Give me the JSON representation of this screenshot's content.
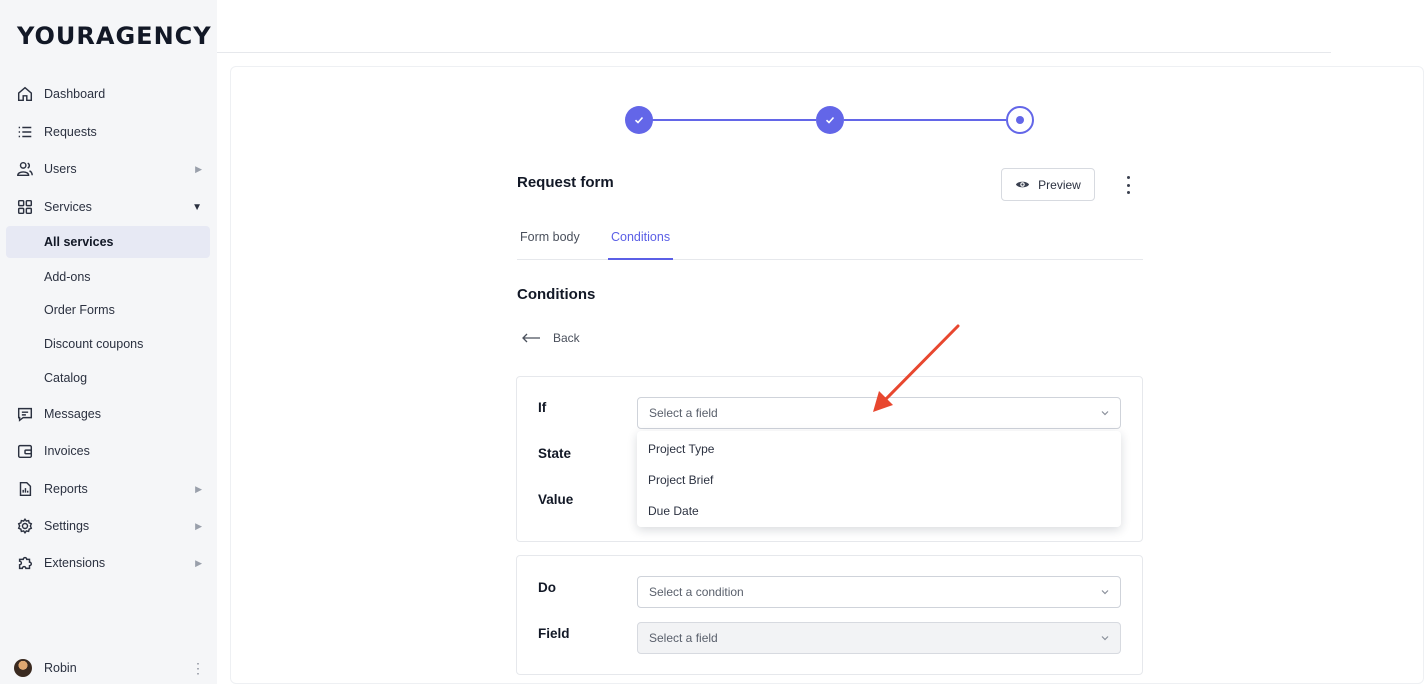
{
  "brand": {
    "logo": "YOURAGENCY"
  },
  "sidebar": {
    "items": [
      {
        "label": "Dashboard"
      },
      {
        "label": "Requests"
      },
      {
        "label": "Users"
      },
      {
        "label": "Services"
      },
      {
        "label": "Messages"
      },
      {
        "label": "Invoices"
      },
      {
        "label": "Reports"
      },
      {
        "label": "Settings"
      },
      {
        "label": "Extensions"
      }
    ],
    "services_sub": [
      {
        "label": "All services",
        "active": true
      },
      {
        "label": "Add-ons"
      },
      {
        "label": "Order Forms"
      },
      {
        "label": "Discount coupons"
      },
      {
        "label": "Catalog"
      }
    ],
    "user": {
      "name": "Robin"
    }
  },
  "header": {
    "title": "Request form",
    "preview_label": "Preview"
  },
  "stepper": {
    "total_steps": 3,
    "current_step": 3
  },
  "tabs": [
    {
      "label": "Form body"
    },
    {
      "label": "Conditions",
      "active": true
    }
  ],
  "conditions": {
    "title": "Conditions",
    "back_label": "Back",
    "if_panel": {
      "if_label": "If",
      "state_label": "State",
      "value_label": "Value",
      "field_placeholder": "Select a field",
      "dropdown_options": [
        "Project Type",
        "Project Brief",
        "Due Date"
      ]
    },
    "do_panel": {
      "do_label": "Do",
      "field_label": "Field",
      "condition_placeholder": "Select a condition",
      "field_placeholder": "Select a field"
    }
  },
  "colors": {
    "accent": "#6366e8",
    "annotation_arrow": "#e8472f",
    "active_nav_bg": "#e7e9f4"
  }
}
